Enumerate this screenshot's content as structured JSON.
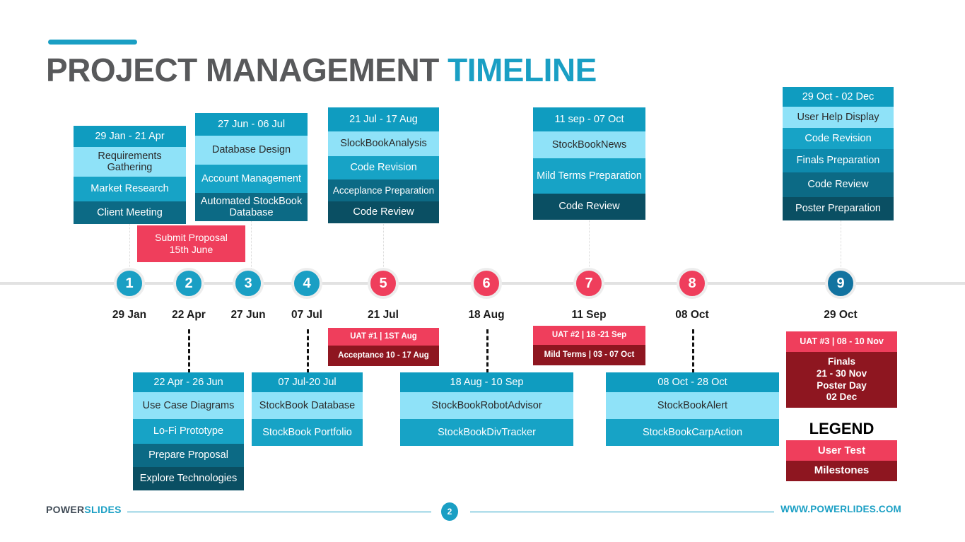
{
  "header": {
    "title_main": "PROJECT MANAGEMENT",
    "title_accent": "TIMELINE"
  },
  "timeline": {
    "markers": [
      {
        "num": "1",
        "date": "29 Jan",
        "color": "blue"
      },
      {
        "num": "2",
        "date": "22 Apr",
        "color": "blue"
      },
      {
        "num": "3",
        "date": "27 Jun",
        "color": "blue"
      },
      {
        "num": "4",
        "date": "07 Jul",
        "color": "blue"
      },
      {
        "num": "5",
        "date": "21 Jul",
        "color": "pink"
      },
      {
        "num": "6",
        "date": "18 Aug",
        "color": "pink"
      },
      {
        "num": "7",
        "date": "11 Sep",
        "color": "pink"
      },
      {
        "num": "8",
        "date": "08 Oct",
        "color": "pink"
      },
      {
        "num": "9",
        "date": "29 Oct",
        "color": "blue-dark"
      }
    ]
  },
  "top_cards": [
    {
      "header": "29 Jan - 21 Apr",
      "rows": [
        "Requirements Gathering",
        "Market Research",
        "Client Meeting"
      ]
    },
    {
      "header": "27 Jun - 06 Jul",
      "rows": [
        "Database Design",
        "Account Management",
        "Automated StockBook Database"
      ]
    },
    {
      "header": "21 Jul - 17 Aug",
      "rows": [
        "SlockBookAnalysis",
        "Code Revision",
        "Acceplance Preparation",
        "Code Review"
      ]
    },
    {
      "header": "11 sep - 07 Oct",
      "rows": [
        "StockBookNews",
        "Mild Terms Preparation",
        "Code Review"
      ]
    },
    {
      "header": "29 Oct - 02 Dec",
      "rows": [
        "User Help Display",
        "Code Revision",
        "Finals Preparation",
        "Code Review",
        "Poster Preparation"
      ]
    }
  ],
  "bottom_cards": [
    {
      "header": "22 Apr - 26 Jun",
      "rows": [
        "Use Case Diagrams",
        "Lo-Fi Prototype",
        "Prepare Proposal",
        "Explore Technologies"
      ]
    },
    {
      "header": "07 Jul-20 Jul",
      "rows": [
        "StockBook Database",
        "StockBook Portfolio"
      ]
    },
    {
      "header": "18 Aug - 10 Sep",
      "rows": [
        "StockBookRobotAdvisor",
        "StockBookDivTracker"
      ]
    },
    {
      "header": "08 Oct - 28 Oct",
      "rows": [
        "StockBookAlert",
        "StockBookCarpAction"
      ]
    }
  ],
  "milestones": {
    "submit_proposal": {
      "line1": "Submit Proposal",
      "line2": "15th June"
    },
    "uat1": {
      "top": "UAT #1 |  1ST Aug",
      "bottom": "Acceptance 10 - 17 Aug"
    },
    "uat2": {
      "top": "UAT #2 | 18 -21 Sep",
      "bottom": "Mild Terms | 03 - 07 Oct"
    },
    "uat3": {
      "top": "UAT #3 | 08 - 10 Nov",
      "bottom": "Finals\n21 - 30 Nov\nPoster Day\n02 Dec",
      "bottom_lines": [
        "Finals",
        "21 - 30 Nov",
        "Poster Day",
        "02 Dec"
      ]
    }
  },
  "legend": {
    "title": "LEGEND",
    "user_test": "User Test",
    "milestones": "Milestones"
  },
  "footer": {
    "logo_bold": "POWER",
    "logo_light": "SLIDES",
    "page": "2",
    "url": "WWW.POWERLIDES.COM"
  },
  "colors": {
    "accent": "#1a9fc4",
    "pink": "#ef3e5c",
    "dark_red": "#8e1620",
    "title_gray": "#58595b"
  }
}
